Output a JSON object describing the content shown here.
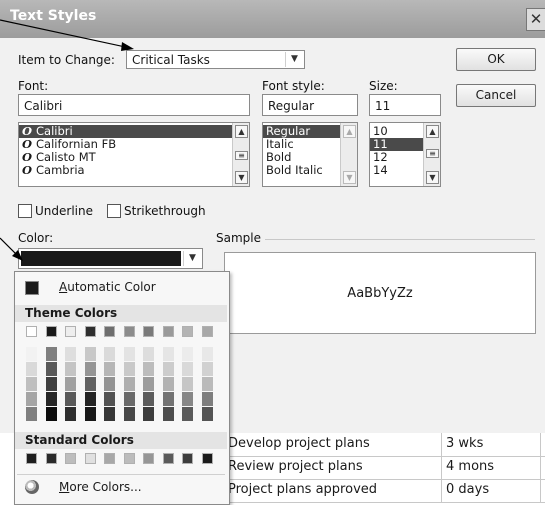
{
  "dialog": {
    "title": "Text Styles",
    "close_glyph": "✕",
    "item_to_change_label": "Item to Change:",
    "item_to_change_value": "Critical Tasks",
    "ok_label": "OK",
    "cancel_label": "Cancel",
    "font": {
      "label": "Font:",
      "value": "Calibri",
      "items": [
        "Calibri",
        "Californian FB",
        "Calisto MT",
        "Cambria"
      ],
      "selected_index": 0
    },
    "font_style": {
      "label": "Font style:",
      "value": "Regular",
      "items": [
        "Regular",
        "Italic",
        "Bold",
        "Bold Italic"
      ],
      "selected_index": 0
    },
    "size": {
      "label": "Size:",
      "value": "11",
      "items": [
        "10",
        "11",
        "12",
        "14"
      ],
      "selected_index": 1
    },
    "underline_label": "Underline",
    "strikethrough_label": "Strikethrough",
    "color_label": "Color:",
    "color_value": "#1a1a1a",
    "sample_label": "Sample",
    "sample_text": "AaBbYyZz"
  },
  "color_picker": {
    "automatic_label": "Automatic Color",
    "automatic_underline_char": "A",
    "theme_label": "Theme Colors",
    "theme_top_row": [
      "#ffffff",
      "#1a1a1a",
      "#eeeeee",
      "#2e2e2e",
      "#6e6e6e",
      "#8c8c8c",
      "#7a7a7a",
      "#9a9a9a",
      "#b4b4b4",
      "#a8a8a8"
    ],
    "theme_shades": [
      [
        "#f2f2f2",
        "#7f7f7f",
        "#dedede",
        "#c8c8c8",
        "#dadada",
        "#e3e3e3",
        "#dddddd",
        "#e5e5e5",
        "#ececec",
        "#e8e8e8"
      ],
      [
        "#d9d9d9",
        "#595959",
        "#c4c4c4",
        "#959595",
        "#b6b6b6",
        "#c9c9c9",
        "#bcbcbc",
        "#cccccc",
        "#d9d9d9",
        "#d1d1d1"
      ],
      [
        "#bfbfbf",
        "#3f3f3f",
        "#a0a0a0",
        "#616161",
        "#939393",
        "#aeaeae",
        "#9c9c9c",
        "#b2b2b2",
        "#c6c6c6",
        "#bababa"
      ],
      [
        "#a5a5a5",
        "#262626",
        "#595959",
        "#232323",
        "#525252",
        "#6a6a6a",
        "#5c5c5c",
        "#737373",
        "#878787",
        "#7e7e7e"
      ],
      [
        "#7f7f7f",
        "#0c0c0c",
        "#2d2d2d",
        "#171717",
        "#363636",
        "#474747",
        "#3d3d3d",
        "#4d4d4d",
        "#5a5a5a",
        "#545454"
      ]
    ],
    "standard_label": "Standard Colors",
    "standard_colors": [
      "#1e1e1e",
      "#2a2a2a",
      "#bdbdbd",
      "#e0e0e0",
      "#a8a8a8",
      "#bcbcbc",
      "#969696",
      "#5a5a5a",
      "#3c3c3c",
      "#1a1a1a"
    ],
    "more_colors_label": "More Colors...",
    "more_colors_underline_char": "M"
  },
  "background_table": {
    "rows": [
      {
        "name": "Develop project plans",
        "duration": "3 wks"
      },
      {
        "name": "Review project plans",
        "duration": "4 mons"
      },
      {
        "name": "Project plans approved",
        "duration": "0 days"
      }
    ]
  }
}
